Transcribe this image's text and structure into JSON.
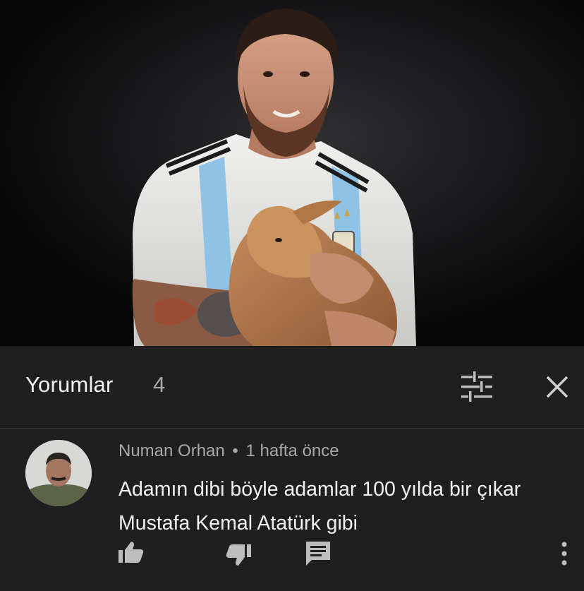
{
  "panel": {
    "title": "Yorumlar",
    "count": "4"
  },
  "comment": {
    "author": "Numan Orhan",
    "separator": "•",
    "time": "1 hafta önce",
    "text": "Adamın dibi böyle adamlar 100 yılda bir çıkar Mustafa Kemal Atatürk gibi"
  },
  "icons": {
    "sort": "sort-filter-icon",
    "close": "close-icon",
    "like": "thumbs-up-icon",
    "dislike": "thumbs-down-icon",
    "reply": "reply-comment-icon",
    "more": "more-vert-icon"
  },
  "colors": {
    "panel_bg": "#1f1f1f",
    "text_primary": "#f1f1f1",
    "text_secondary": "#aaaaaa",
    "jersey_blue": "#8fc3e6"
  }
}
